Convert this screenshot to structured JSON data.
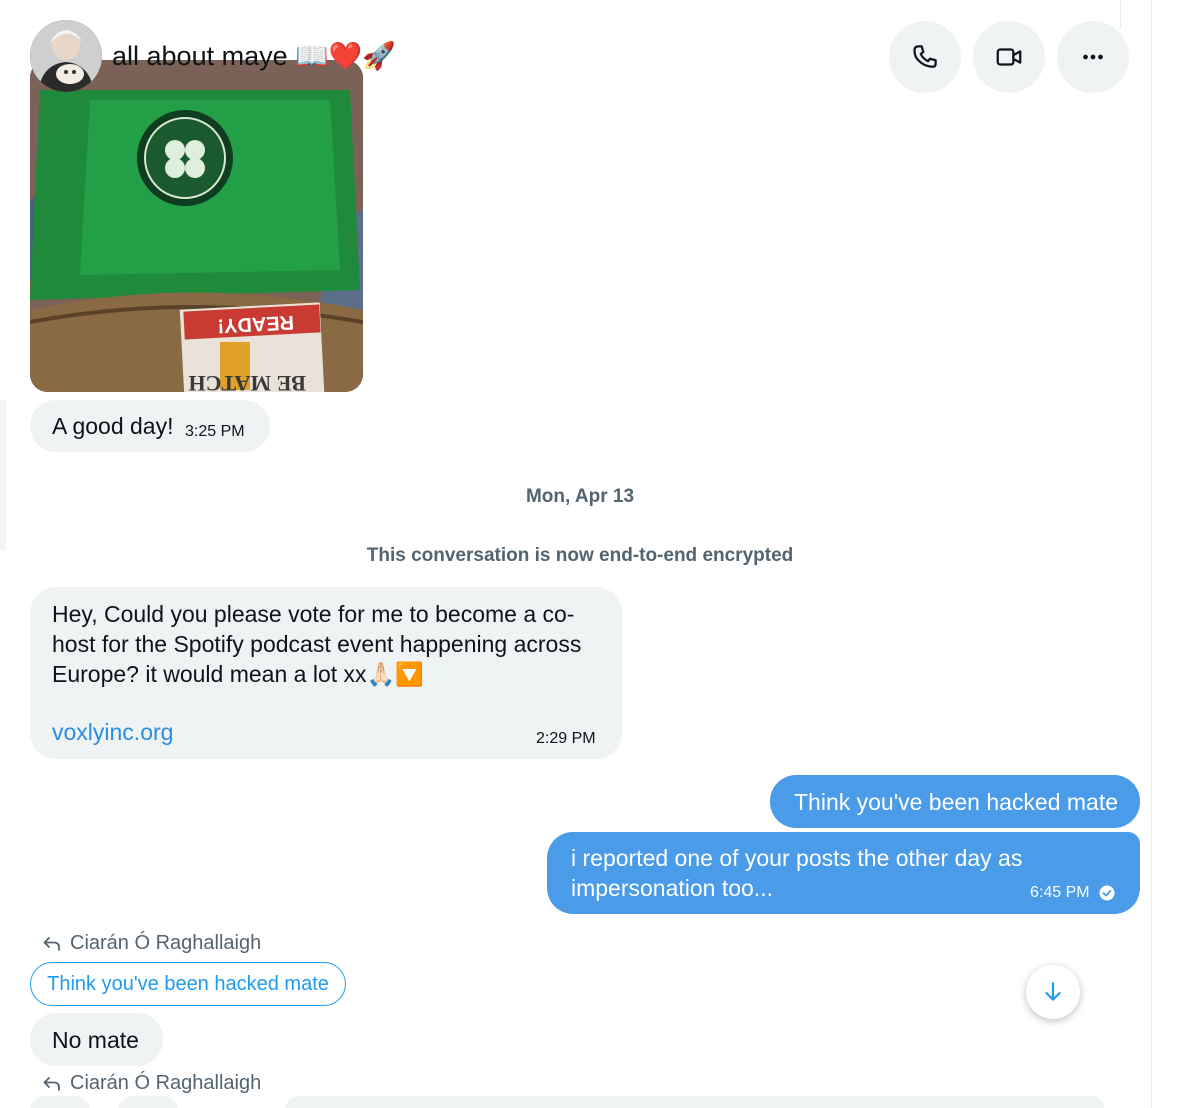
{
  "header": {
    "title": "all about maye 📖❤️🚀",
    "call_icon": "phone-icon",
    "video_icon": "video-camera-icon",
    "more_icon": "more-dots-icon"
  },
  "messages": {
    "photo_caption": {
      "text": "A good day!",
      "time": "3:25 PM"
    },
    "date_separator": "Mon, Apr 13",
    "encryption_notice": "This conversation is now end-to-end encrypted",
    "vote_request": {
      "line1": "Hey, Could you please vote for me to become a co-",
      "line2": "host for the Spotify podcast event happening across",
      "line3": "Europe? it would mean a lot xx🙏🏻🔽",
      "link": "voxlyinc.org",
      "time": "2:29 PM"
    },
    "outgoing_1": {
      "text": "Think you've been hacked mate"
    },
    "outgoing_2": {
      "line1": "i reported one of your posts the other day as",
      "line2": "impersonation too...",
      "time": "6:45 PM",
      "status_icon": "read-check-icon"
    },
    "reply_1": {
      "label": "Ciarán Ó Raghallaigh",
      "quoted": "Think you've been hacked mate",
      "text": "No mate"
    },
    "reply_2": {
      "label": "Ciarán Ó Raghallaigh"
    }
  },
  "colors": {
    "accent": "#1d9bf0",
    "outgoing_bubble": "#4a9be8",
    "incoming_bubble": "#eff3f4",
    "muted_text": "#536471"
  }
}
